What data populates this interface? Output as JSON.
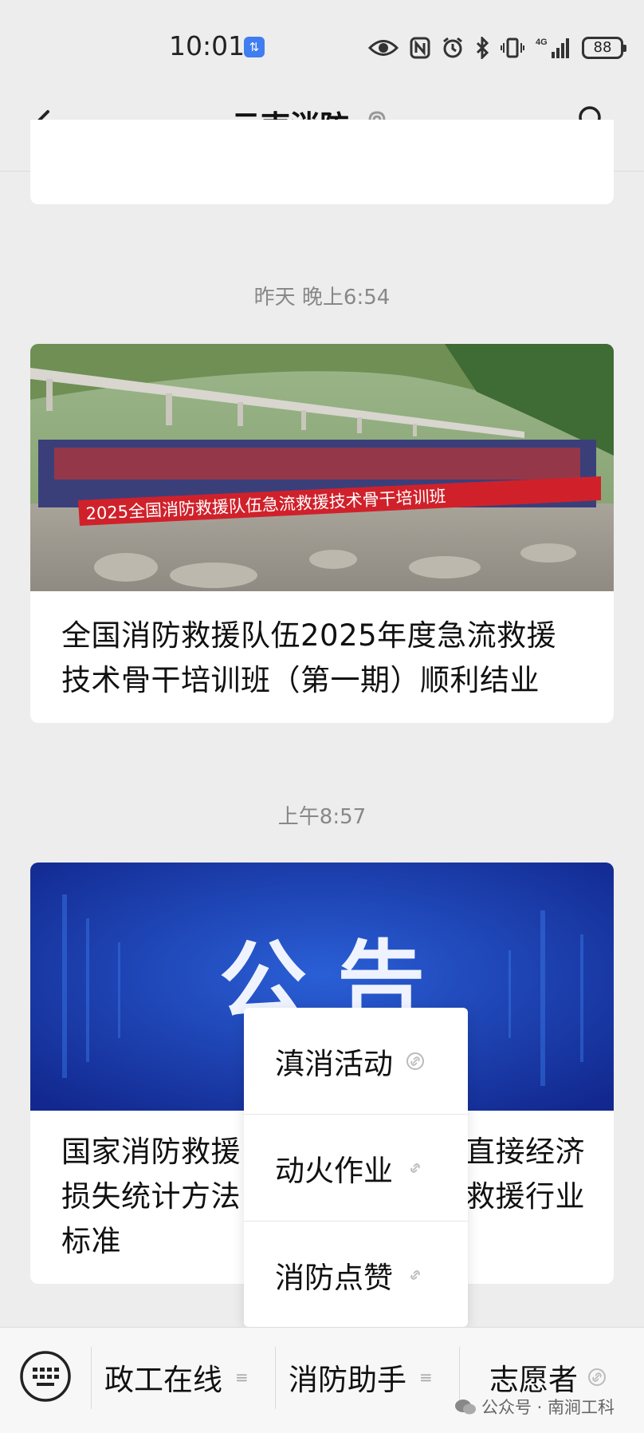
{
  "status": {
    "time": "10:01",
    "network": "4G",
    "battery": "88"
  },
  "nav": {
    "title": "云南消防"
  },
  "timestamps": [
    "昨天 晚上6:54",
    "上午8:57"
  ],
  "articles": [
    {
      "image_banner_text": "2025全国消防救援队伍急流救援技术骨干培训班",
      "title": "全国消防救援队伍2025年度急流救援技术骨干培训班（第一期）顺利结业"
    },
    {
      "image_text": "公 告",
      "title_line1_left": "国家消防救援",
      "title_line1_right": "直接经济",
      "title_line2_left": "损失统计方法",
      "title_line2_right": "救援行业",
      "title_line3": "标准"
    }
  ],
  "popup_menu": [
    "滇消活动",
    "动火作业",
    "消防点赞"
  ],
  "bottom_menu": [
    "政工在线",
    "消防助手",
    "志愿者"
  ],
  "watermark": "公众号 · 南涧工科",
  "colors": {
    "accent_blue": "#3f7df0",
    "banner_red": "#d0212b",
    "notice_blue": "#1f3fae"
  }
}
